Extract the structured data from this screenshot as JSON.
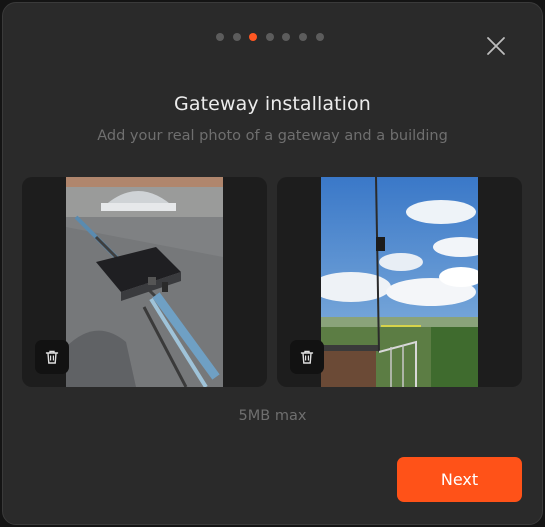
{
  "stepper": {
    "steps": [
      {
        "label": "step-1",
        "active": false
      },
      {
        "label": "step-2",
        "active": false
      },
      {
        "label": "step-3",
        "active": true
      },
      {
        "label": "step-4",
        "active": false
      },
      {
        "label": "step-5",
        "active": false
      },
      {
        "label": "step-6",
        "active": false
      },
      {
        "label": "step-7",
        "active": false
      }
    ],
    "current": 3,
    "total": 7
  },
  "dialog": {
    "title": "Gateway installation",
    "subtitle": "Add your real photo of a gateway and a building",
    "size_limit": "5MB max",
    "next_label": "Next"
  },
  "photos": [
    {
      "subject": "gateway on rooftop",
      "delete_icon": "trash-icon"
    },
    {
      "subject": "antenna mast and building",
      "delete_icon": "trash-icon"
    }
  ],
  "colors": {
    "accent": "#ff5218",
    "background": "#2a2a2a",
    "card": "#1d1d1d",
    "title": "#ececec",
    "muted": "#6f6f6f"
  }
}
